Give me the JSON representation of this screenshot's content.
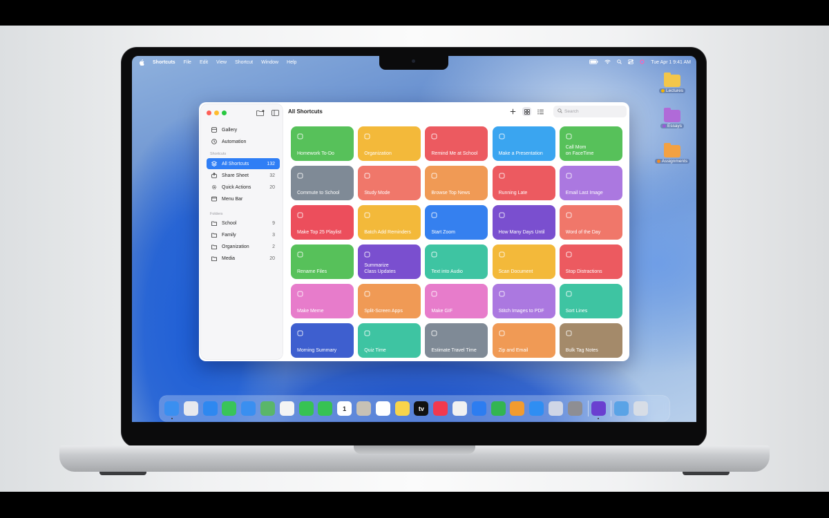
{
  "menubar": {
    "app_name": "Shortcuts",
    "menus": [
      "File",
      "Edit",
      "View",
      "Shortcut",
      "Window",
      "Help"
    ],
    "datetime": "Tue Apr 1  9:41 AM"
  },
  "desktop": {
    "folders": [
      {
        "label": "Lectures",
        "tag_color": "#f4b400",
        "folder_color": "#f3c64a"
      },
      {
        "label": "Essays",
        "tag_color": "#9b59d6",
        "folder_color": "#b06ad8"
      },
      {
        "label": "Assignments",
        "tag_color": "#f08a24",
        "folder_color": "#f3a142"
      }
    ]
  },
  "window": {
    "title": "All Shortcuts",
    "search_placeholder": "Search",
    "sidebar": {
      "top": [
        {
          "label": "Gallery",
          "icon": "gallery-icon"
        },
        {
          "label": "Automation",
          "icon": "clock-icon"
        }
      ],
      "shortcuts_header": "Shortcuts",
      "shortcuts": [
        {
          "label": "All Shortcuts",
          "count": "132",
          "icon": "stack-icon",
          "active": true
        },
        {
          "label": "Share Sheet",
          "count": "32",
          "icon": "share-icon"
        },
        {
          "label": "Quick Actions",
          "count": "20",
          "icon": "gear-icon"
        },
        {
          "label": "Menu Bar",
          "count": "",
          "icon": "menubar-icon"
        }
      ],
      "folders_header": "Folders",
      "folders": [
        {
          "label": "School",
          "count": "9"
        },
        {
          "label": "Family",
          "count": "3"
        },
        {
          "label": "Organization",
          "count": "2"
        },
        {
          "label": "Media",
          "count": "20"
        }
      ]
    },
    "cards": [
      {
        "label": "Homework To-Do",
        "color": "#57c15a"
      },
      {
        "label": "Organization",
        "color": "#f3b93a"
      },
      {
        "label": "Remind Me at School",
        "color": "#ec5a60"
      },
      {
        "label": "Make a Presentation",
        "color": "#3aa5f0"
      },
      {
        "label": "Call Mom\non FaceTime",
        "color": "#57c15a"
      },
      {
        "label": "Commute to School",
        "color": "#7f8a96"
      },
      {
        "label": "Study Mode",
        "color": "#f0776a"
      },
      {
        "label": "Browse Top News",
        "color": "#f09a55"
      },
      {
        "label": "Running Late",
        "color": "#ec5a60"
      },
      {
        "label": "Email Last Image",
        "color": "#ab78e0"
      },
      {
        "label": "Make Top 25 Playlist",
        "color": "#ec4e5c"
      },
      {
        "label": "Batch Add Reminders",
        "color": "#f3b93a"
      },
      {
        "label": "Start Zoom",
        "color": "#3580ef"
      },
      {
        "label": "How Many Days Until",
        "color": "#7a4fcf"
      },
      {
        "label": "Word of the Day",
        "color": "#f0776a"
      },
      {
        "label": "Rename Files",
        "color": "#57c15a"
      },
      {
        "label": "Summarize\nClass Updates",
        "color": "#7a4fcf"
      },
      {
        "label": "Text into Audio",
        "color": "#3ec4a2"
      },
      {
        "label": "Scan Document",
        "color": "#f3b93a"
      },
      {
        "label": "Stop Distractions",
        "color": "#ec5a60"
      },
      {
        "label": "Make Meme",
        "color": "#e77ccb"
      },
      {
        "label": "Split-Screen Apps",
        "color": "#f09a55"
      },
      {
        "label": "Make GIF",
        "color": "#e77ccb"
      },
      {
        "label": "Stitch Images to PDF",
        "color": "#ab78e0"
      },
      {
        "label": "Sort Lines",
        "color": "#3ec4a2"
      },
      {
        "label": "Morning Summary",
        "color": "#3e5fcf"
      },
      {
        "label": "Quiz Time",
        "color": "#3ec4a2"
      },
      {
        "label": "Estimate Travel Time",
        "color": "#7f8a96"
      },
      {
        "label": "Zip and Email",
        "color": "#f09a55"
      },
      {
        "label": "Bulk Tag Notes",
        "color": "#a48a6a"
      }
    ]
  },
  "dock": {
    "apps": [
      {
        "name": "finder",
        "color": "#3a8ff0",
        "glyph": ""
      },
      {
        "name": "launchpad",
        "color": "#e7e9ee",
        "glyph": ""
      },
      {
        "name": "safari",
        "color": "#2e88f0",
        "glyph": ""
      },
      {
        "name": "messages",
        "color": "#39c45a",
        "glyph": ""
      },
      {
        "name": "mail",
        "color": "#3a8ff0",
        "glyph": ""
      },
      {
        "name": "maps",
        "color": "#5ab66a",
        "glyph": ""
      },
      {
        "name": "photos",
        "color": "#f4f4f4",
        "glyph": ""
      },
      {
        "name": "facetime",
        "color": "#37c253",
        "glyph": ""
      },
      {
        "name": "phone",
        "color": "#37c253",
        "glyph": ""
      },
      {
        "name": "calendar",
        "color": "#ffffff",
        "glyph": "1"
      },
      {
        "name": "contacts",
        "color": "#c7c1b5",
        "glyph": ""
      },
      {
        "name": "reminders",
        "color": "#ffffff",
        "glyph": ""
      },
      {
        "name": "notes",
        "color": "#f8d44a",
        "glyph": ""
      },
      {
        "name": "tv",
        "color": "#111111",
        "glyph": "tv"
      },
      {
        "name": "music",
        "color": "#f2394e",
        "glyph": ""
      },
      {
        "name": "news",
        "color": "#f1f1f1",
        "glyph": ""
      },
      {
        "name": "keynote",
        "color": "#2d7df0",
        "glyph": ""
      },
      {
        "name": "numbers",
        "color": "#33b552",
        "glyph": ""
      },
      {
        "name": "pages",
        "color": "#f29b2f",
        "glyph": ""
      },
      {
        "name": "app-store",
        "color": "#2f8ef2",
        "glyph": ""
      },
      {
        "name": "iphone-mirroring",
        "color": "#cfd6e6",
        "glyph": ""
      },
      {
        "name": "system-settings",
        "color": "#8e8e93",
        "glyph": ""
      },
      {
        "name": "shortcuts",
        "color": "#6a3fd0",
        "glyph": ""
      },
      {
        "name": "downloads",
        "color": "#5aa3e6",
        "glyph": ""
      },
      {
        "name": "trash",
        "color": "#d7dde6",
        "glyph": ""
      }
    ]
  }
}
